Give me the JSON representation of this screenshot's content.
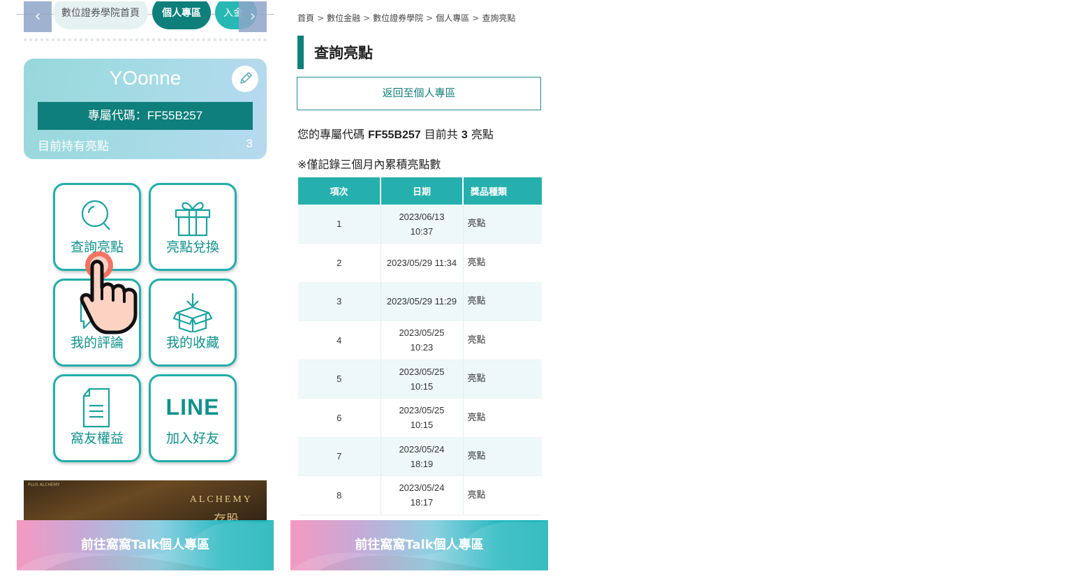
{
  "left": {
    "tabs": {
      "prev_arrow": "‹",
      "next_arrow": "›",
      "home": "數位證券學院首頁",
      "active": "個人專區",
      "next": "入金"
    },
    "profile": {
      "name": "YOonne",
      "code_text": "專屬代碼：FF55B257",
      "points_label": "目前持有亮點",
      "points_value": "3"
    },
    "tiles": [
      {
        "label": "查詢亮點",
        "icon": "search-icon"
      },
      {
        "label": "亮點兌換",
        "icon": "gift-icon"
      },
      {
        "label": "我的評論",
        "icon": "chat-icon"
      },
      {
        "label": "我的收藏",
        "icon": "download-box-icon"
      },
      {
        "label": "窩友權益",
        "icon": "document-icon"
      },
      {
        "label": "加入好友",
        "icon": "line-icon",
        "word": "LINE"
      }
    ],
    "banner": {
      "brand": "ALCHEMY",
      "sub": "存股",
      "small": "PLUS ALCHEMY"
    },
    "cta": "前往窩窩Talk個人專區"
  },
  "right": {
    "breadcrumb": [
      "首頁",
      "數位金融",
      "數位證券學院",
      "個人專區",
      "查詢亮點"
    ],
    "breadcrumb_sep": ">",
    "title": "查詢亮點",
    "back_button": "返回至個人專區",
    "summary": {
      "prefix": "您的專屬代碼",
      "code": "FF55B257",
      "middle": "目前共",
      "count": "3",
      "suffix": "亮點"
    },
    "note": "※僅記錄三個月內累積亮點數",
    "table": {
      "headers": [
        "項次",
        "日期",
        "獎品種類"
      ],
      "rows": [
        {
          "no": "1",
          "date": "2023/06/13",
          "time": "10:37",
          "kind": "亮點"
        },
        {
          "no": "2",
          "date": "2023/05/29",
          "time": "11:34",
          "kind": "亮點"
        },
        {
          "no": "3",
          "date": "2023/05/29",
          "time": "11:29",
          "kind": "亮點"
        },
        {
          "no": "4",
          "date": "2023/05/25",
          "time": "10:23",
          "kind": "亮點"
        },
        {
          "no": "5",
          "date": "2023/05/25",
          "time": "10:15",
          "kind": "亮點"
        },
        {
          "no": "6",
          "date": "2023/05/25",
          "time": "10:15",
          "kind": "亮點"
        },
        {
          "no": "7",
          "date": "2023/05/24",
          "time": "18:19",
          "kind": "亮點"
        },
        {
          "no": "8",
          "date": "2023/05/24",
          "time": "18:17",
          "kind": "亮點"
        }
      ]
    },
    "cta": "前往窩窩Talk個人專區"
  },
  "colors": {
    "primary_teal": "#0e7f7b",
    "accent_teal": "#26b0ad",
    "pink": "#f49ac1"
  }
}
